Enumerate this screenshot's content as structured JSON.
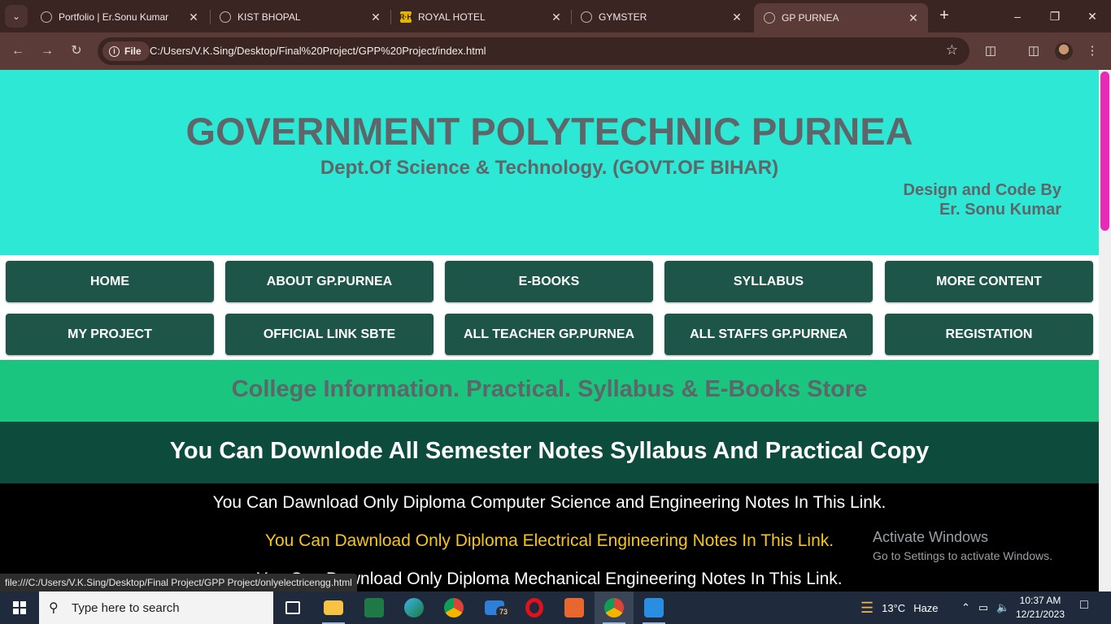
{
  "browser": {
    "tabs": [
      {
        "title": "Portfolio | Er.Sonu Kumar",
        "icon": "globe-icon"
      },
      {
        "title": "KIST BHOPAL",
        "icon": "globe-icon"
      },
      {
        "title": "ROYAL HOTEL",
        "icon": "rh-logo-icon",
        "icon_text": "R·H"
      },
      {
        "title": "GYMSTER",
        "icon": "globe-icon"
      },
      {
        "title": "GP PURNEA",
        "icon": "globe-icon",
        "active": true
      }
    ],
    "address": {
      "chip_label": "File",
      "url": "C:/Users/V.K.Sing/Desktop/Final%20Project/GPP%20Project/index.html"
    },
    "status_url": "file:///C:/Users/V.K.Sing/Desktop/Final Project/GPP Project/onlyelectricengg.html"
  },
  "page": {
    "header": {
      "title": "GOVERNMENT POLYTECHNIC PURNEA",
      "subtitle": "Dept.Of Science & Technology. (GOVT.OF BIHAR)",
      "credit_line1": "Design and Code By",
      "credit_line2": "Er. Sonu Kumar"
    },
    "nav": [
      "HOME",
      "ABOUT GP.PURNEA",
      "E-BOOKS",
      "SYLLABUS",
      "MORE CONTENT",
      "MY PROJECT",
      "OFFICIAL LINK SBTE",
      "ALL TEACHER GP.PURNEA",
      "ALL STAFFS GP.PURNEA",
      "REGISTATION"
    ],
    "info_banner": "College Information. Practical. Syllabus & E-Books Store",
    "notes_banner": "You Can Downlode All Semester Notes Syllabus And Practical Copy",
    "links": [
      "You Can Dawnload Only Diploma Computer Science and Engineering Notes In This Link.",
      "You Can Dawnload Only Diploma Electrical Engineering Notes In This Link.",
      "You Can Dawnload Only Diploma Mechanical Engineering Notes In This Link."
    ],
    "hovered_link_index": 1
  },
  "watermark": {
    "line1": "Activate Windows",
    "line2": "Go to Settings to activate Windows."
  },
  "taskbar": {
    "search_placeholder": "Type here to search",
    "mail_badge": "73",
    "weather_temp": "13°C",
    "weather_desc": "Haze",
    "time": "10:37 AM",
    "date": "12/21/2023"
  },
  "colors": {
    "header_bg": "#2ee8d6",
    "nav_button_bg": "#1d5649",
    "info_band_bg": "#19c57f",
    "notes_band_bg": "#0d4c3c",
    "hover_link": "#f5c518",
    "scroll_thumb": "#e62bb7"
  }
}
